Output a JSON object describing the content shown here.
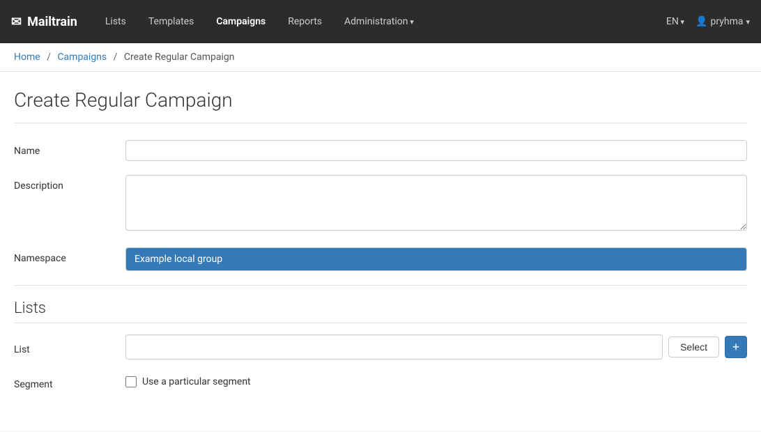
{
  "brand": {
    "name": "Mailtrain",
    "icon": "✉"
  },
  "navbar": {
    "links": [
      {
        "id": "lists",
        "label": "Lists",
        "active": false
      },
      {
        "id": "templates",
        "label": "Templates",
        "active": false
      },
      {
        "id": "campaigns",
        "label": "Campaigns",
        "active": true
      },
      {
        "id": "reports",
        "label": "Reports",
        "active": false
      },
      {
        "id": "administration",
        "label": "Administration",
        "active": false,
        "dropdown": true
      }
    ],
    "lang": "EN",
    "user": "pryhma",
    "user_icon": "👤"
  },
  "breadcrumb": {
    "home": "Home",
    "campaigns": "Campaigns",
    "current": "Create Regular Campaign"
  },
  "page": {
    "title": "Create Regular Campaign"
  },
  "form": {
    "name_label": "Name",
    "name_placeholder": "",
    "description_label": "Description",
    "description_placeholder": "",
    "namespace_label": "Namespace",
    "namespace_value": "Example local group"
  },
  "lists_section": {
    "title": "Lists",
    "list_label": "List",
    "list_placeholder": "",
    "select_button": "Select",
    "add_button": "+"
  },
  "segment_section": {
    "label": "Segment",
    "checkbox_label": "Use a particular segment",
    "checked": false
  }
}
